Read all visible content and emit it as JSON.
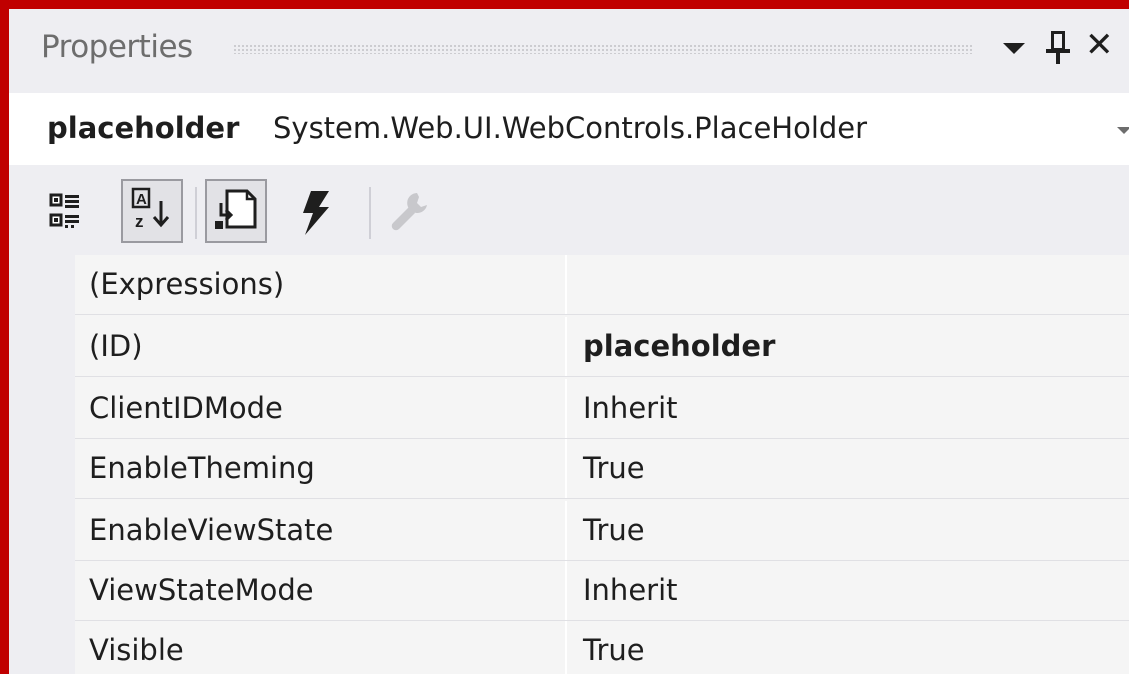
{
  "panel": {
    "title": "Properties"
  },
  "object": {
    "name": "placeholder",
    "type": "System.Web.UI.WebControls.PlaceHolder"
  },
  "toolbar": {
    "buttons": [
      {
        "icon": "categorized-icon",
        "pressed": false
      },
      {
        "icon": "alphabetical-sort-icon",
        "pressed": true
      },
      {
        "icon": "properties-icon",
        "pressed": true
      },
      {
        "icon": "events-lightning-icon",
        "pressed": false
      },
      {
        "icon": "property-pages-wrench-icon",
        "pressed": false,
        "disabled": true
      }
    ]
  },
  "grid": {
    "rows": [
      {
        "name": "(Expressions)",
        "value": ""
      },
      {
        "name": "(ID)",
        "value": "placeholder",
        "bold": true
      },
      {
        "name": "ClientIDMode",
        "value": "Inherit"
      },
      {
        "name": "EnableTheming",
        "value": "True"
      },
      {
        "name": "EnableViewState",
        "value": "True"
      },
      {
        "name": "ViewStateMode",
        "value": "Inherit"
      },
      {
        "name": "Visible",
        "value": "True"
      }
    ]
  },
  "colors": {
    "highlight_border": "#c00000",
    "panel_background": "#eeeef2",
    "grid_background": "#f5f5f5"
  }
}
